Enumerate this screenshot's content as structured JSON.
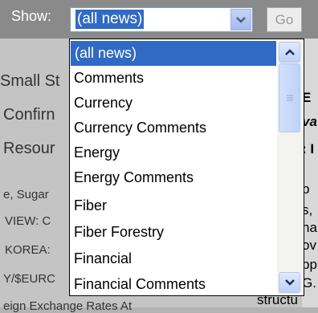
{
  "toolbar": {
    "show_label": "Show:",
    "selected_value": "(all news)",
    "go_label": "Go"
  },
  "background": {
    "lines_left": [
      "Small St",
      "Confirn",
      "Resour",
      "e, Sugar",
      "VIEW: C",
      "KOREA: ",
      "Y/$EURC",
      "eign Exchange Rates At"
    ],
    "lines_right": [
      "E",
      "va",
      ": I",
      "p",
      "s,",
      "ha",
      "ov",
      "pp",
      "G.",
      "structu"
    ]
  },
  "dropdown": {
    "items": [
      "(all news)",
      "Comments",
      "Currency",
      "Currency Comments",
      "Energy",
      "Energy Comments",
      "Fiber",
      "Fiber Forestry",
      "Financial",
      "Financial Comments"
    ],
    "selected_index": 0
  },
  "colors": {
    "selection": "#316ac5",
    "toolbar": "#8a8a8a"
  }
}
